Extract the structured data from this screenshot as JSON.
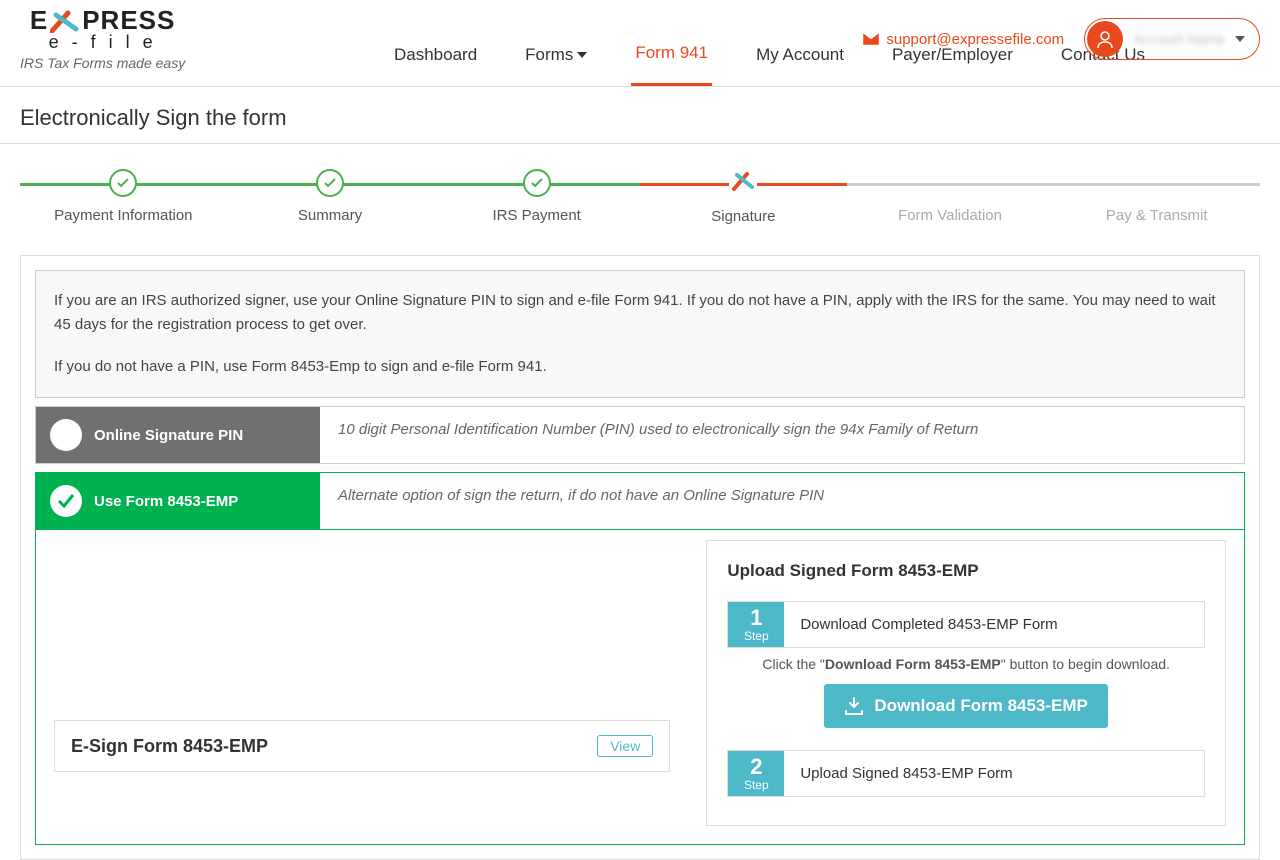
{
  "brand": {
    "name": "EXPRESS",
    "sub": "e-file",
    "tagline": "IRS Tax Forms made easy"
  },
  "header": {
    "support_email": "support@expressefile.com",
    "user_name": "Account Name"
  },
  "nav": {
    "dashboard": "Dashboard",
    "forms": "Forms",
    "form941": "Form 941",
    "my_account": "My Account",
    "payer": "Payer/Employer",
    "contact": "Contact Us"
  },
  "page_title": "Electronically Sign the form",
  "steps": {
    "s1": "Payment Information",
    "s2": "Summary",
    "s3": "IRS Payment",
    "s4": "Signature",
    "s5": "Form Validation",
    "s6": "Pay & Transmit"
  },
  "info": {
    "p1": "If you are an IRS authorized signer, use your Online Signature PIN to sign and e-file Form 941. If you do not have a PIN, apply with the IRS for the same. You may need to wait 45 days for the registration process to get over.",
    "p2": "If you do not have a PIN, use Form 8453-Emp to sign and e-file Form 941."
  },
  "option_pin": {
    "title": "Online Signature PIN",
    "desc": "10 digit Personal Identification Number (PIN) used to electronically sign the 94x Family of Return"
  },
  "option_8453": {
    "title": "Use Form 8453-EMP",
    "desc": "Alternate option of sign the return, if do not have an Online Signature PIN"
  },
  "upload": {
    "panel_title": "Upload Signed Form 8453-EMP",
    "step1_num": "1",
    "step_word": "Step",
    "step1_label": "Download Completed 8453-EMP Form",
    "help_pre": "Click the \"",
    "help_bold": "Download Form 8453-EMP",
    "help_post": "\" button to begin download.",
    "download_btn": "Download Form 8453-EMP",
    "step2_num": "2",
    "step2_label": "Upload Signed 8453-EMP Form"
  },
  "esign": {
    "title": "E-Sign Form 8453-EMP",
    "view": "View"
  }
}
